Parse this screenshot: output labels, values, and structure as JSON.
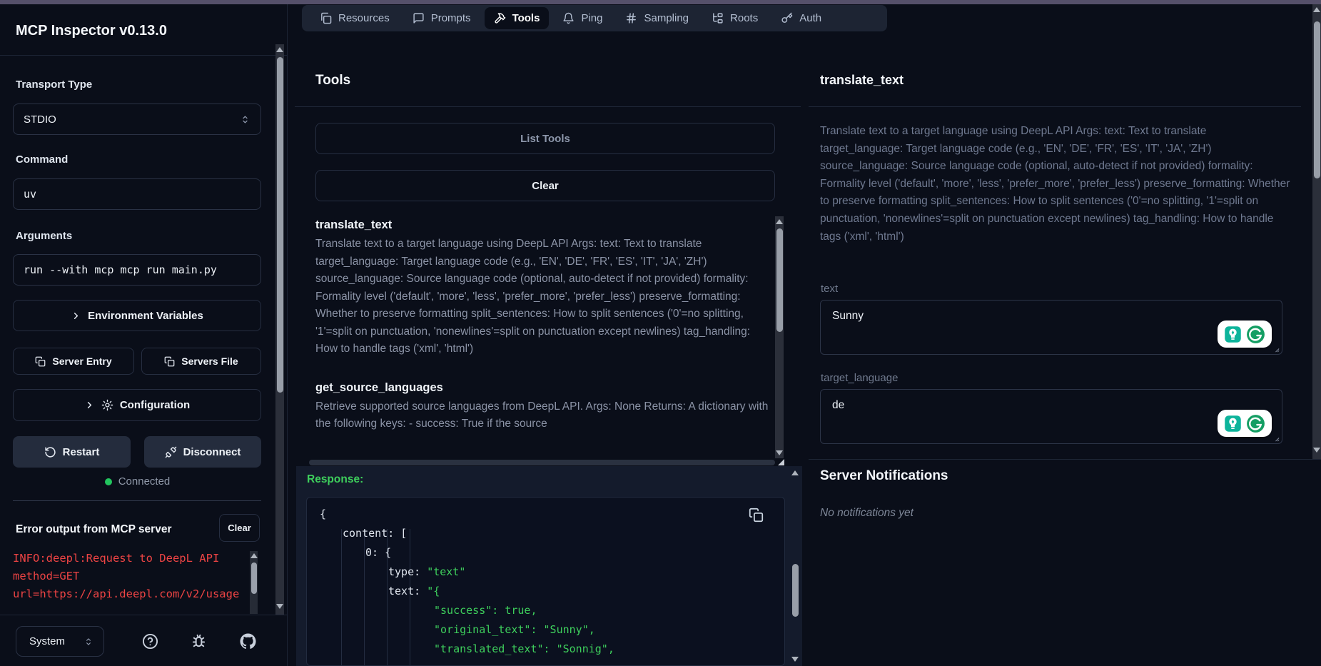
{
  "colors": {
    "accent_green": "#22c55e",
    "json_green": "#3ecf5c",
    "error_red": "#ee4444",
    "top_strip": "#55506a",
    "panel_bg": "#141b2c"
  },
  "sidebar": {
    "title": "MCP Inspector v0.13.0",
    "transport": {
      "label": "Transport Type",
      "value": "STDIO"
    },
    "command": {
      "label": "Command",
      "value": "uv"
    },
    "arguments": {
      "label": "Arguments",
      "value": "run --with mcp mcp run main.py"
    },
    "env_vars_button": "Environment Variables",
    "server_entry_button": "Server Entry",
    "servers_file_button": "Servers File",
    "configuration_button": "Configuration",
    "restart_button": "Restart",
    "disconnect_button": "Disconnect",
    "status": "Connected",
    "error_section": {
      "title": "Error output from MCP server",
      "clear_button": "Clear",
      "lines": [
        "INFO:deepl:Request to DeepL API",
        "method=GET",
        "url=https://api.deepl.com/v2/usage"
      ]
    },
    "footer": {
      "theme_select": "System"
    }
  },
  "nav": {
    "tabs": [
      {
        "label": "Resources",
        "icon": "files-icon",
        "active": false
      },
      {
        "label": "Prompts",
        "icon": "message-square-icon",
        "active": false
      },
      {
        "label": "Tools",
        "icon": "hammer-icon",
        "active": true
      },
      {
        "label": "Ping",
        "icon": "bell-icon",
        "active": false
      },
      {
        "label": "Sampling",
        "icon": "hash-icon",
        "active": false
      },
      {
        "label": "Roots",
        "icon": "tree-icon",
        "active": false
      },
      {
        "label": "Auth",
        "icon": "key-icon",
        "active": false
      }
    ]
  },
  "tools_panel": {
    "title": "Tools",
    "list_tools_button": "List Tools",
    "clear_button": "Clear",
    "tools": [
      {
        "name": "translate_text",
        "description": "Translate text to a target language using DeepL API Args: text: Text to translate target_language: Target language code (e.g., 'EN', 'DE', 'FR', 'ES', 'IT', 'JA', 'ZH') source_language: Source language code (optional, auto-detect if not provided) formality: Formality level ('default', 'more', 'less', 'prefer_more', 'prefer_less') preserve_formatting: Whether to preserve formatting split_sentences: How to split sentences ('0'=no splitting, '1'=split on punctuation, 'nonewlines'=split on punctuation except newlines) tag_handling: How to handle tags ('xml', 'html')"
      },
      {
        "name": "get_source_languages",
        "description": "Retrieve supported source languages from DeepL API. Args: None Returns: A dictionary with the following keys: - success: True if the source"
      }
    ]
  },
  "tool_detail": {
    "title": "translate_text",
    "description": "Translate text to a target language using DeepL API Args: text: Text to translate target_language: Target language code (e.g., 'EN', 'DE', 'FR', 'ES', 'IT', 'JA', 'ZH') source_language: Source language code (optional, auto-detect if not provided) formality: Formality level ('default', 'more', 'less', 'prefer_more', 'prefer_less') preserve_formatting: Whether to preserve formatting split_sentences: How to split sentences ('0'=no splitting, '1'=split on punctuation, 'nonewlines'=split on punctuation except newlines) tag_handling: How to handle tags ('xml', 'html')",
    "fields": [
      {
        "label": "text",
        "value": "Sunny"
      },
      {
        "label": "target_language",
        "value": "de"
      }
    ]
  },
  "response_panel": {
    "label": "Response:",
    "lines": [
      {
        "key": "{",
        "val": ""
      },
      {
        "key": "content: [",
        "val": ""
      },
      {
        "key": "0: {",
        "val": ""
      },
      {
        "key": "type: ",
        "val": "\"text\""
      },
      {
        "key": "text: ",
        "val": "\"{"
      },
      {
        "key": "",
        "val": "\"success\": true,"
      },
      {
        "key": "",
        "val": "\"original_text\": \"Sunny\","
      },
      {
        "key": "",
        "val": "\"translated_text\": \"Sonnig\","
      }
    ]
  },
  "notifications": {
    "title": "Server Notifications",
    "empty_message": "No notifications yet"
  }
}
